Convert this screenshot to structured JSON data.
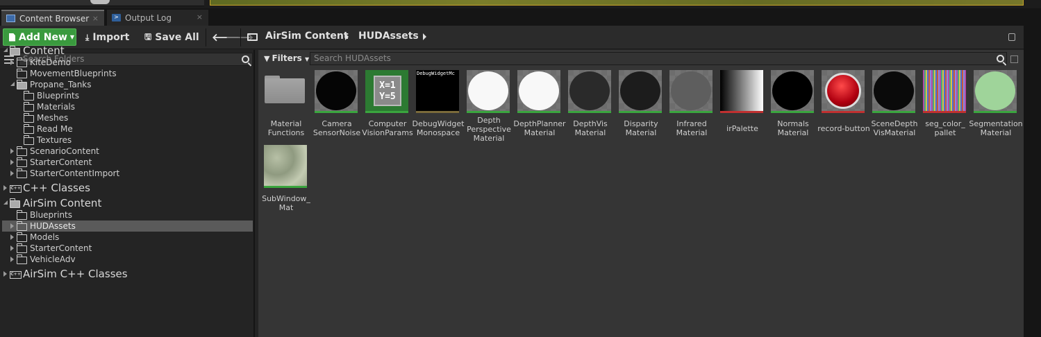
{
  "tabs": [
    {
      "label": "Content Browser",
      "active": true
    },
    {
      "label": "Output Log",
      "active": false
    }
  ],
  "tab_close_glyph": "×",
  "toolbar": {
    "add_new": "Add New",
    "import": "Import",
    "save_all": "Save All"
  },
  "breadcrumb": [
    "AirSim Content",
    "HUDAssets"
  ],
  "sources": {
    "search_placeholder": "Search Folders",
    "tree": [
      {
        "label": "Content",
        "level": "root",
        "expander": "expanded"
      },
      {
        "label": "KiteDemo",
        "level": 1,
        "expander": "collapsed"
      },
      {
        "label": "MovementBlueprints",
        "level": 1,
        "expander": "none"
      },
      {
        "label": "Propane_Tanks",
        "level": 1,
        "expander": "expanded"
      },
      {
        "label": "Blueprints",
        "level": 2,
        "expander": "none"
      },
      {
        "label": "Materials",
        "level": 2,
        "expander": "none"
      },
      {
        "label": "Meshes",
        "level": 2,
        "expander": "none"
      },
      {
        "label": "Read Me",
        "level": 2,
        "expander": "none"
      },
      {
        "label": "Textures",
        "level": 2,
        "expander": "none"
      },
      {
        "label": "ScenarioContent",
        "level": 1,
        "expander": "collapsed"
      },
      {
        "label": "StarterContent",
        "level": 1,
        "expander": "collapsed"
      },
      {
        "label": "StarterContentImport",
        "level": 1,
        "expander": "collapsed"
      },
      {
        "label": "C++ Classes",
        "level": "root",
        "expander": "collapsed"
      },
      {
        "label": "AirSim Content",
        "level": "root",
        "expander": "expanded"
      },
      {
        "label": "Blueprints",
        "level": 1,
        "expander": "none"
      },
      {
        "label": "HUDAssets",
        "level": 1,
        "expander": "collapsed",
        "selected": true
      },
      {
        "label": "Models",
        "level": 1,
        "expander": "collapsed"
      },
      {
        "label": "StarterContent",
        "level": 1,
        "expander": "collapsed"
      },
      {
        "label": "VehicleAdv",
        "level": 1,
        "expander": "collapsed"
      },
      {
        "label": "AirSim C++ Classes",
        "level": "root",
        "expander": "collapsed"
      }
    ]
  },
  "assets": {
    "filters_label": "Filters",
    "search_placeholder": "Search HUDAssets",
    "items": [
      {
        "name": "Material Functions",
        "lines": [
          "Material",
          "Functions"
        ],
        "kind": "folder"
      },
      {
        "name": "CameraSensorNoise",
        "lines": [
          "Camera",
          "SensorNoise"
        ],
        "kind": "material",
        "color": "#050505",
        "bar": "#3aa53e"
      },
      {
        "name": "ComputerVisionParams",
        "lines": [
          "Computer",
          "VisionParams"
        ],
        "kind": "struct",
        "bar": "#3aa53e",
        "icon_text": [
          "X=1",
          "Y=5"
        ]
      },
      {
        "name": "DebugWidgetMonospace",
        "lines": [
          "DebugWidget",
          "Monospace"
        ],
        "kind": "font",
        "bar": "#7a6a3a",
        "preview_text": "DebugWidgetMc"
      },
      {
        "name": "DepthPerspectiveMaterial",
        "lines": [
          "Depth",
          "Perspective",
          "Material"
        ],
        "kind": "material",
        "color": "#f8f8f8",
        "bar": "#3aa53e"
      },
      {
        "name": "DepthPlannerMaterial",
        "lines": [
          "DepthPlanner",
          "Material"
        ],
        "kind": "material",
        "color": "#f8f8f8",
        "bar": "#3aa53e"
      },
      {
        "name": "DepthVisMaterial",
        "lines": [
          "DepthVis",
          "Material"
        ],
        "kind": "material",
        "color": "#2a2a2a",
        "bar": "#3aa53e"
      },
      {
        "name": "DisparityMaterial",
        "lines": [
          "Disparity",
          "Material"
        ],
        "kind": "material",
        "color": "#1c1c1c",
        "bar": "#3aa53e"
      },
      {
        "name": "InfraredMaterial",
        "lines": [
          "Infrared",
          "Material"
        ],
        "kind": "material",
        "color": "#5e5e5e",
        "bar": "#3aa53e"
      },
      {
        "name": "irPalette",
        "lines": [
          "irPalette"
        ],
        "kind": "texture",
        "bar": "#c03030"
      },
      {
        "name": "NormalsMaterial",
        "lines": [
          "Normals",
          "Material"
        ],
        "kind": "material",
        "color": "#000000",
        "bar": "#3aa53e"
      },
      {
        "name": "record-button",
        "lines": [
          "record-button"
        ],
        "kind": "texture-button",
        "bar": "#c03030"
      },
      {
        "name": "SceneDepthVisMaterial",
        "lines": [
          "SceneDepth",
          "VisMaterial"
        ],
        "kind": "material",
        "color": "#0a0a0a",
        "bar": "#3aa53e"
      },
      {
        "name": "seg_color_pallet",
        "lines": [
          "seg_color_",
          "pallet"
        ],
        "kind": "texture-stripes",
        "bar": "#c03030"
      },
      {
        "name": "SegmentationMaterial",
        "lines": [
          "Segmentation",
          "Material"
        ],
        "kind": "material",
        "color": "#9fd49a",
        "bar": "#3aa53e"
      },
      {
        "name": "SubWindow_Mat",
        "lines": [
          "SubWindow_",
          "Mat"
        ],
        "kind": "noise",
        "bar": "#3aa53e"
      }
    ]
  },
  "colors": {
    "add_new_green": "#3a9a3e",
    "material_bar": "#3aa53e",
    "texture_bar": "#c03030",
    "selection": "#5a5a5a"
  }
}
